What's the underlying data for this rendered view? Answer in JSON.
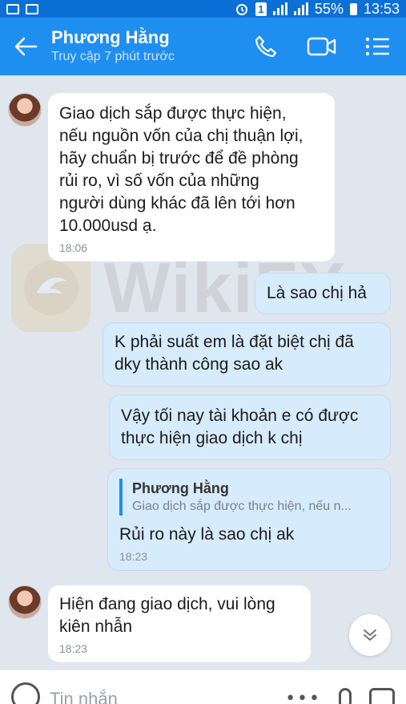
{
  "status_bar": {
    "battery": "55%",
    "time": "13:53",
    "sim_label": "1"
  },
  "header": {
    "contact_name": "Phương Hằng",
    "contact_status": "Truy cập 7 phút trước"
  },
  "watermark": {
    "text": "WikiFX"
  },
  "messages": [
    {
      "direction": "in",
      "text_lines": [
        "Giao dịch sắp được thực hiện,",
        "nếu nguồn vốn của chị thuận lợi,",
        "hãy chuẩn bị trước để đề phòng",
        "rủi ro, vì số vốn của những",
        "người dùng khác đã lên tới hơn",
        "10.000usd ạ."
      ],
      "time": "18:06"
    },
    {
      "direction": "out",
      "text_lines": [
        "Là sao chị hả"
      ]
    },
    {
      "direction": "out",
      "text_lines": [
        "K phải suất em là đặt biệt chị đã",
        "dky thành công sao ak"
      ]
    },
    {
      "direction": "out",
      "text_lines": [
        "Vậy tối nay tài khoản e có được",
        "thực hiện giao dịch k chị"
      ]
    },
    {
      "direction": "out",
      "quote_name": "Phương Hằng",
      "quote_text": "Giao dịch sắp được thực hiện, nếu n...",
      "text_lines": [
        "Rủi ro này là sao chị ak"
      ],
      "time": "18:23"
    },
    {
      "direction": "in",
      "text_lines": [
        "Hiện đang giao dịch, vui lòng",
        "kiên nhẫn"
      ],
      "time": "18:23"
    }
  ],
  "input": {
    "placeholder": "Tin nhắn"
  },
  "colors": {
    "header": "#1f8ef1",
    "status_bar": "#0b6fd8",
    "bubble_out": "#d6ebfb",
    "bubble_in": "#ffffff",
    "chat_bg": "#dfe6ee"
  },
  "icons": [
    "gallery-icon",
    "mail-icon",
    "alarm-icon",
    "sim-icon",
    "signal-icon",
    "battery-icon",
    "back-arrow-icon",
    "phone-icon",
    "video-call-icon",
    "menu-list-icon",
    "chevron-down-icon",
    "emoji-icon",
    "more-icon",
    "mic-icon",
    "image-icon"
  ]
}
